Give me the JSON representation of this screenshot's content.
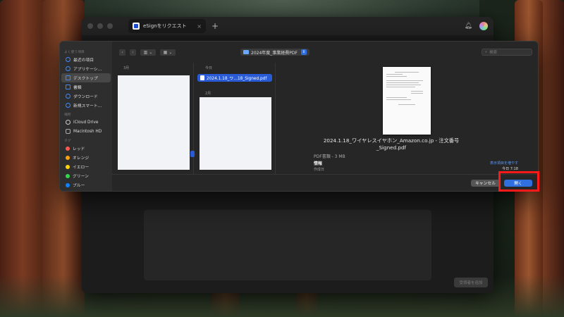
{
  "app": {
    "tab_title": "eSignをリクエスト",
    "tab_close": "×",
    "new_tab": "+",
    "add_button": "受領者を追加"
  },
  "dialog": {
    "sidebar": {
      "favorites_header": "よく使う項目",
      "favorites": [
        {
          "label": "最近の項目",
          "icon": "clock-icon"
        },
        {
          "label": "アプリケーシ…",
          "icon": "apps-icon"
        },
        {
          "label": "デスクトップ",
          "icon": "desktop-icon",
          "selected": true
        },
        {
          "label": "書類",
          "icon": "document-icon"
        },
        {
          "label": "ダウンロード",
          "icon": "download-icon"
        },
        {
          "label": "新規スマート…",
          "icon": "smart-folder-icon"
        }
      ],
      "locations_header": "場所",
      "locations": [
        {
          "label": "iCloud Drive",
          "icon": "cloud-icon"
        },
        {
          "label": "Macintosh HD",
          "icon": "disk-icon"
        }
      ],
      "tags_header": "タグ",
      "tags": [
        {
          "label": "レッド",
          "color": "#ff5a52"
        },
        {
          "label": "オレンジ",
          "color": "#ff9f0a"
        },
        {
          "label": "イエロー",
          "color": "#ffd60a"
        },
        {
          "label": "グリーン",
          "color": "#32d74b"
        },
        {
          "label": "ブルー",
          "color": "#0a84ff"
        }
      ]
    },
    "toolbar": {
      "back": "‹",
      "forward": "›",
      "path": "2024年度_事業経費PDF",
      "search_placeholder": "検索"
    },
    "columns": {
      "col1_header": "3月",
      "col2_header_today": "今日",
      "col2_header_feb": "2月",
      "selected_file": "2024.1.18_ワ…18_Signed.pdf"
    },
    "preview": {
      "file_name_line1": "2024.1.18_ワイヤレスイヤホン_Amazon.co.jp - 注文番号",
      "file_name_line2": "_Signed.pdf",
      "meta": "PDF書類 - 3 MB",
      "info_header": "情報",
      "show_more": "表示項目を増やす",
      "created_label": "作成日",
      "created_value": "今日 7:18"
    },
    "footer": {
      "cancel": "キャンセル",
      "open": "開く"
    }
  },
  "colors": {
    "accent": "#2f6fe0",
    "highlight": "#ff1a1a"
  }
}
